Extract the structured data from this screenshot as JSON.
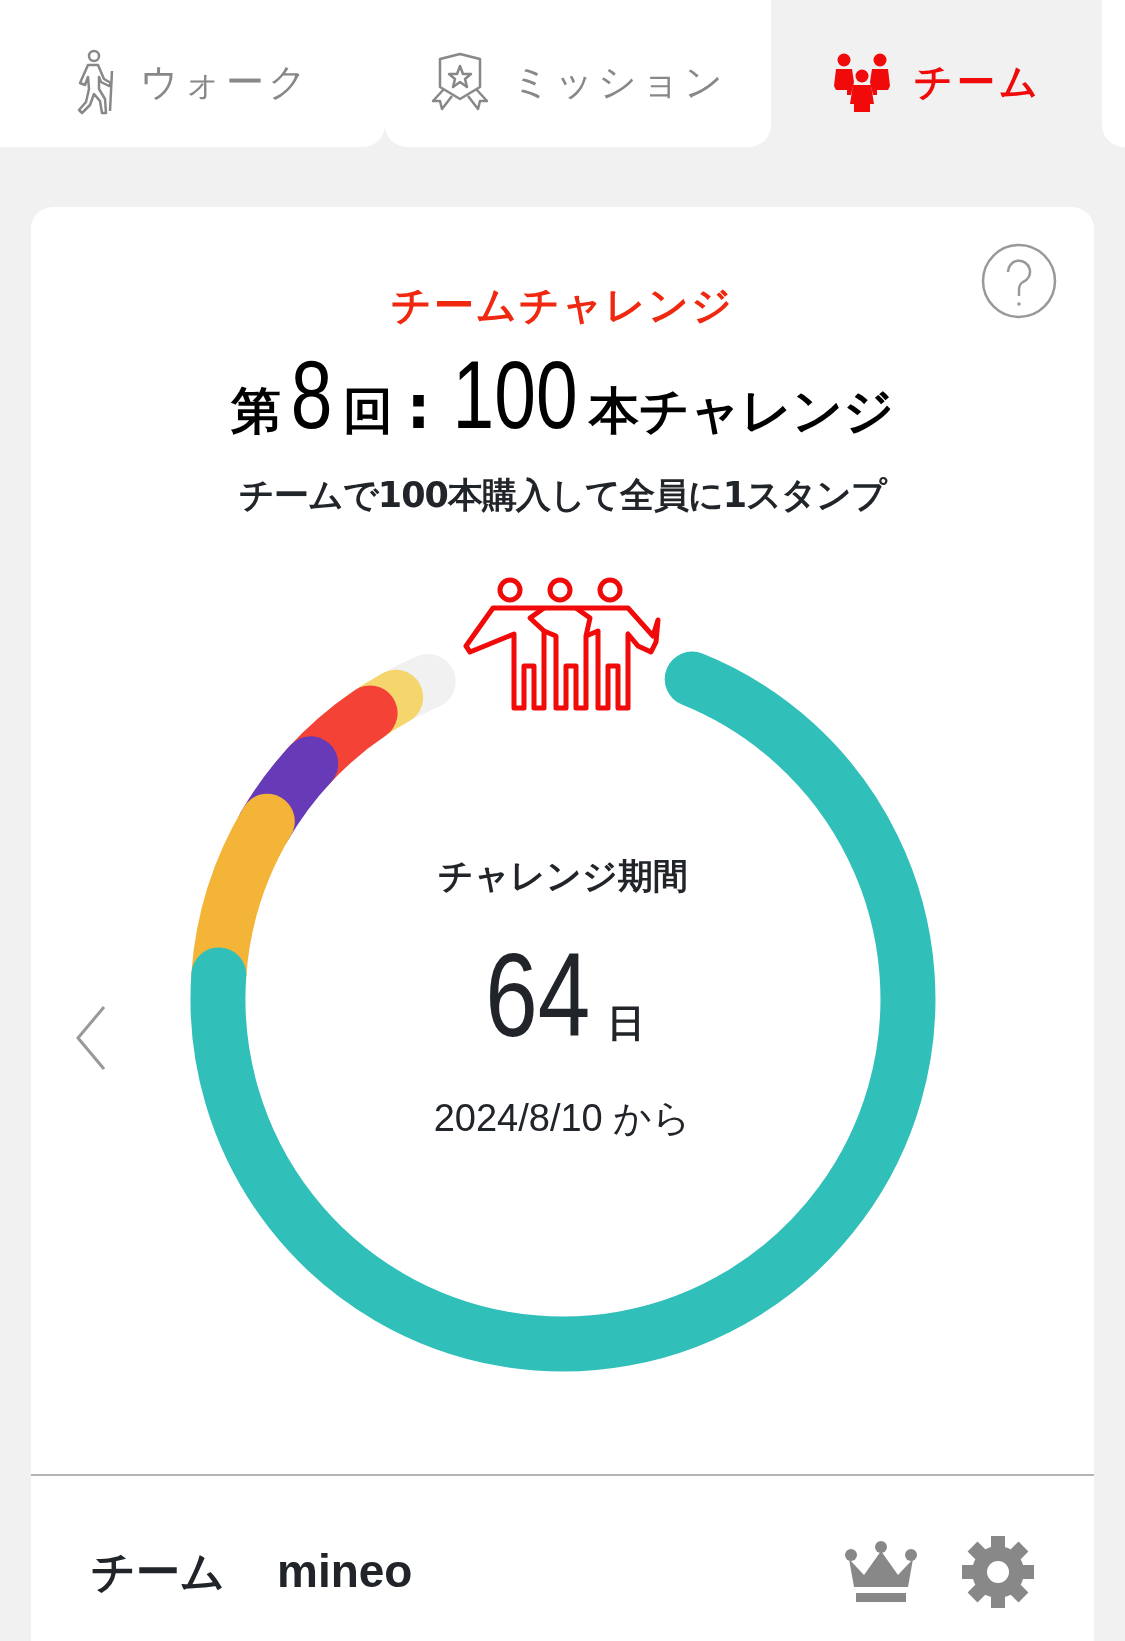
{
  "tabs": [
    {
      "label": "ウォーク",
      "selected": false
    },
    {
      "label": "ミッション",
      "selected": false
    },
    {
      "label": "チーム",
      "selected": true
    }
  ],
  "challenge": {
    "category": "チームチャレンジ",
    "title": {
      "prefix": "第",
      "round": "8",
      "round_suffix": "回",
      "separator": ":",
      "count": "100",
      "count_suffix": "本チャレンジ"
    },
    "description": "チームで100本購入して全員に1スタンプ",
    "period_label": "チャレンジ期間",
    "days": "64",
    "days_unit": "日",
    "start": "2024/8/10 から"
  },
  "team": {
    "label": "チーム",
    "name": "mineo"
  }
}
